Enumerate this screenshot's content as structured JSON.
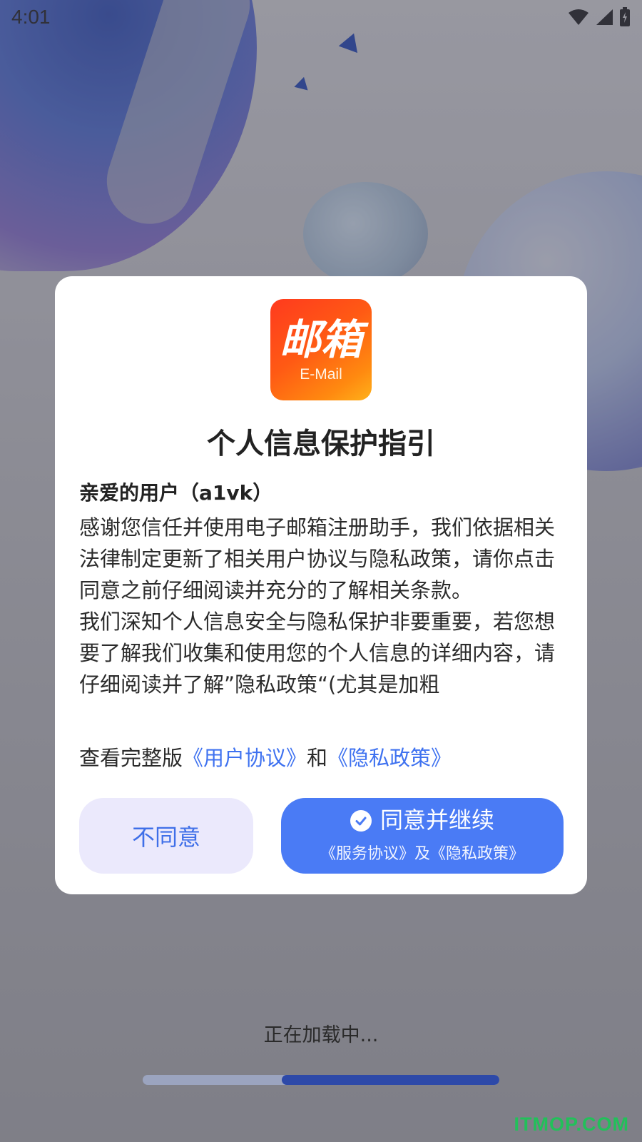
{
  "status_bar": {
    "time": "4:01",
    "icons": [
      "wifi-icon",
      "cellular-signal-icon",
      "battery-charging-icon"
    ]
  },
  "dialog": {
    "logo": {
      "text_cn": "邮箱",
      "text_en": "E-Mail"
    },
    "title": "个人信息保护指引",
    "greeting": "亲爱的用户（a1vk）",
    "paragraphs": [
      "感谢您信任并使用电子邮箱注册助手，我们依据相关法律制定更新了相关用户协议与隐私政策，请你点击同意之前仔细阅读并充分的了解相关条款。",
      "我们深知个人信息安全与隐私保护非要重要，若您想要了解我们收集和使用您的个人信息的详细内容，请仔细阅读并了解”隐私政策“(尤其是加粗"
    ],
    "full_version": {
      "prefix": "查看完整版",
      "user_agreement_link": "《用户协议》",
      "and": "和",
      "privacy_policy_link": "《隐私政策》"
    },
    "buttons": {
      "disagree": "不同意",
      "agree": "同意并继续",
      "agree_sub": "《服务协议》及《隐私政策》"
    }
  },
  "loading": {
    "text": "正在加载中...",
    "progress": 0.61
  },
  "watermark": "ITMOP.COM",
  "colors": {
    "accent": "#4a7bf5",
    "link": "#3f72f0",
    "disagree_bg": "#ebe9fc",
    "logo_gradient_start": "#ff3a1e",
    "logo_gradient_end": "#ffb21a",
    "progress_fill": "#2d49a8"
  }
}
